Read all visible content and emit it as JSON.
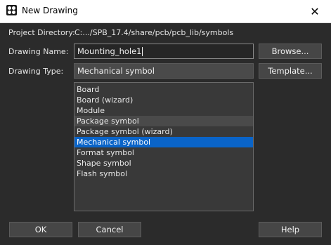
{
  "window": {
    "title": "New Drawing",
    "close_glyph": "✕"
  },
  "project": {
    "label": "Project Directory:",
    "path": "C:.../SPB_17.4/share/pcb/pcb_lib/symbols"
  },
  "drawing_name": {
    "label": "Drawing Name:",
    "value": "Mounting_hole1"
  },
  "drawing_type": {
    "label": "Drawing Type:",
    "value": "Mechanical symbol"
  },
  "buttons": {
    "browse": "Browse...",
    "template": "Template...",
    "ok": "OK",
    "cancel": "Cancel",
    "help": "Help"
  },
  "types_list": [
    "Board",
    "Board (wizard)",
    "Module",
    "Package symbol",
    "Package symbol (wizard)",
    "Mechanical symbol",
    "Format symbol",
    "Shape symbol",
    "Flash symbol"
  ],
  "colors": {
    "selected": "#0a64c8",
    "background": "#2b2b2b"
  }
}
